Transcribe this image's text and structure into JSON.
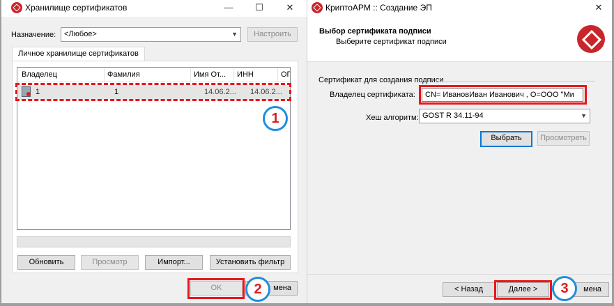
{
  "left_window": {
    "title": "Хранилище сертификатов",
    "controls": {
      "minimize": "—",
      "maximize": "☐",
      "close": "✕"
    },
    "purpose_label": "Назначение:",
    "purpose_value": "<Любое>",
    "configure_button": "Настроить",
    "tab_label": "Личное хранилище сертификатов",
    "columns": [
      "Владелец",
      "Фамилия",
      "Имя От...",
      "ИНН",
      "ОГ"
    ],
    "rows": [
      {
        "owner": "1",
        "surname": "1",
        "name": "14.06.2...",
        "inn": "14.06.2..."
      }
    ],
    "buttons": {
      "refresh": "Обновить",
      "view": "Просмотр",
      "import": "Импорт...",
      "filter": "Установить фильтр",
      "ok": "OK",
      "cancel_partial": "мена"
    }
  },
  "right_window": {
    "title": "КриптоАРМ :: Создание ЭП",
    "close": "✕",
    "header_title": "Выбор сертификата подписи",
    "header_subtitle": "Выберите сертификат подписи",
    "group_title": "Сертификат для создания подписи",
    "owner_label": "Владелец сертификата:",
    "owner_value": "CN= ИвановИван Иванович , O=ООО \"Ми",
    "hash_label": "Хеш алгоритм:",
    "hash_value": "GOST R 34.11-94",
    "select_button": "Выбрать",
    "view_button": "Просмотреть",
    "back_button": "< Назад",
    "next_button": "Далее >",
    "cancel_partial": "мена"
  },
  "annotations": {
    "badge1": "1",
    "badge2": "2",
    "badge3": "3"
  },
  "colors": {
    "highlight": "#e8161c",
    "badge_ring": "#1e8ede",
    "accent": "#0078d7"
  }
}
